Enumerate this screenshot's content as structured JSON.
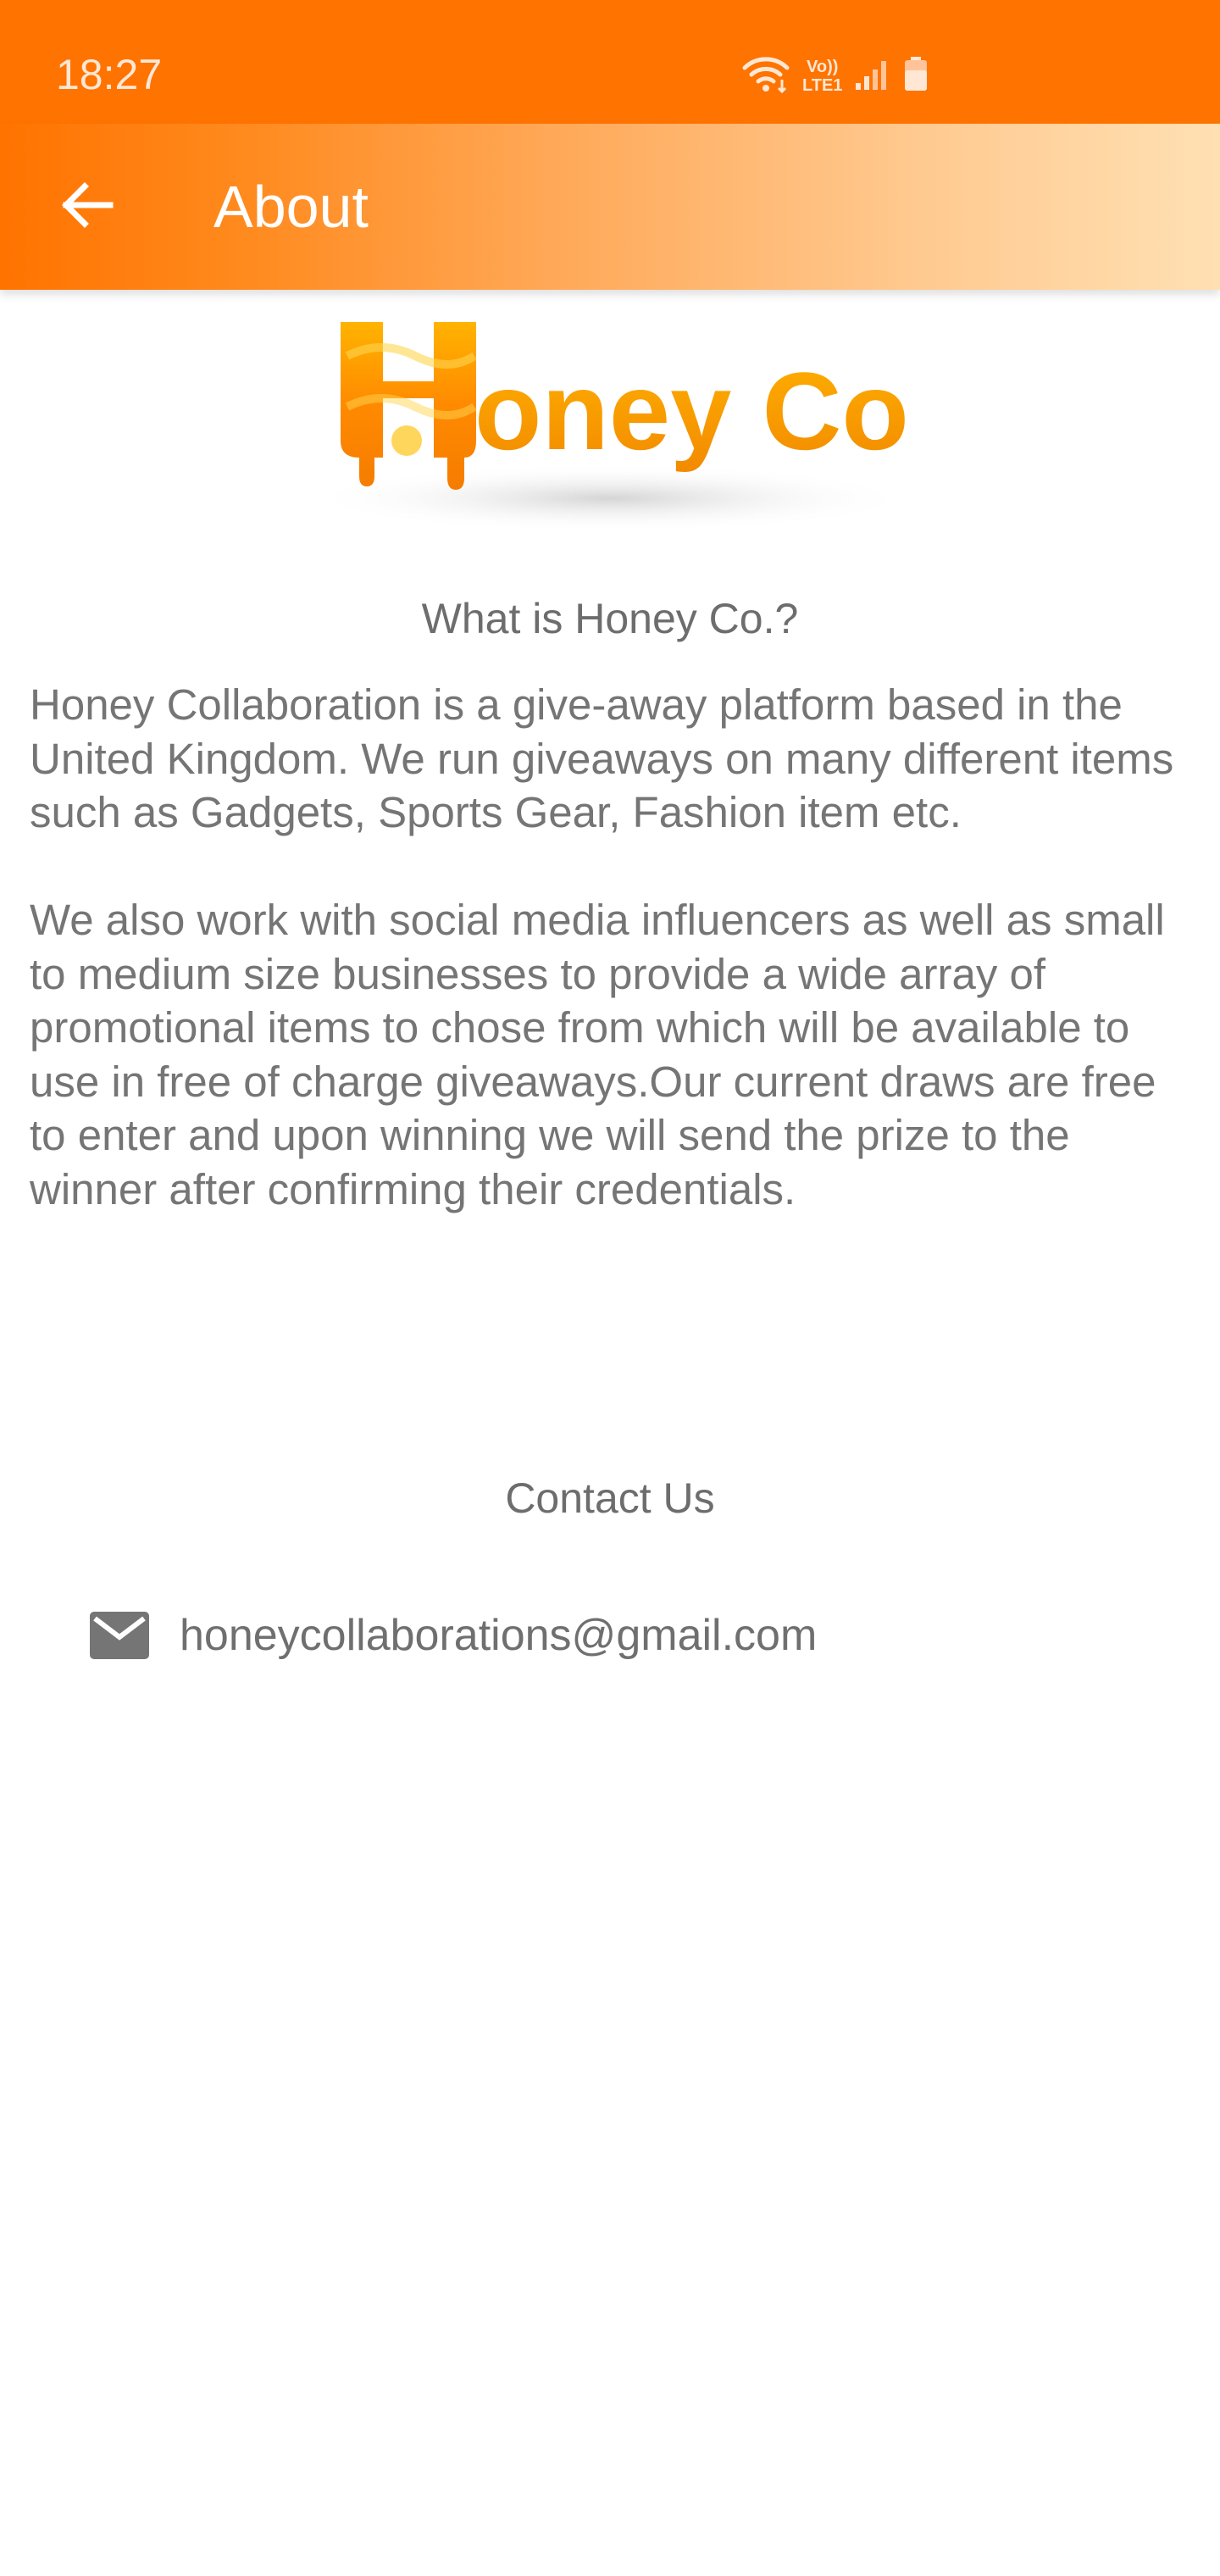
{
  "status_bar": {
    "time": "18:27",
    "network_label_top": "Vo))",
    "network_label_bottom": "LTE1",
    "icons": [
      "wifi-icon",
      "signal-icon",
      "battery-icon"
    ]
  },
  "app_bar": {
    "title": "About",
    "back_icon": "arrow-left-icon"
  },
  "logo": {
    "text": "Honey Co."
  },
  "about": {
    "heading": "What is Honey Co.?",
    "paragraphs": [
      "Honey Collaboration is a give-away platform based in the United Kingdom. We run giveaways on many different items such as Gadgets, Sports Gear, Fashion item etc.",
      "We also work with social media influencers as well as small to medium size businesses to provide a wide array of promotional items to chose from which will be available to use in free of charge giveaways.Our current draws are free to enter and upon winning we will send the prize to the winner after confirming their credentials."
    ]
  },
  "contact": {
    "heading": "Contact Us",
    "email": "honeycollaborations@gmail.com",
    "email_icon": "mail-icon"
  },
  "colors": {
    "primary": "#ff7300",
    "gradient_end": "#ffe0b3",
    "text_gray": "#757575"
  }
}
